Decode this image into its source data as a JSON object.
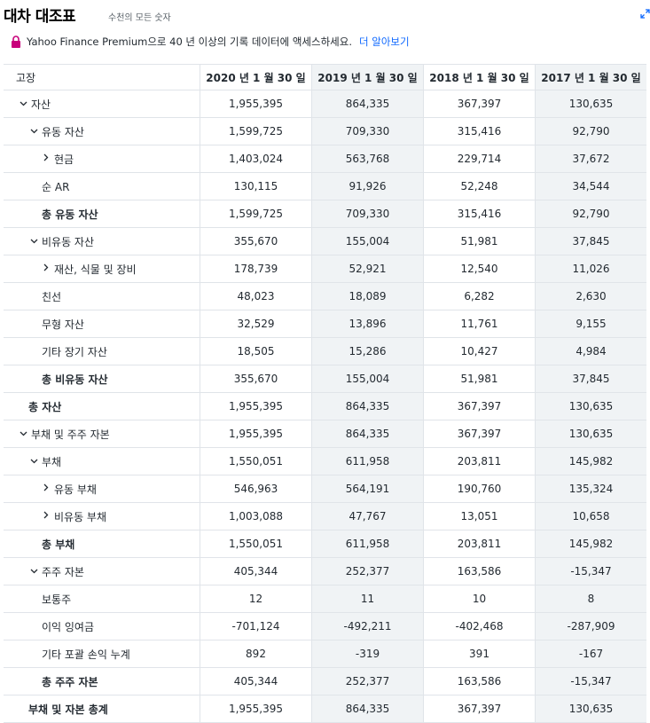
{
  "header": {
    "title": "대차 대조표",
    "subtitle": "수천의 모든 숫자"
  },
  "promo": {
    "text": "Yahoo Finance Premium으로 40 년 이상의 기록 데이터에 액세스하세요.",
    "link": "더 알아보기",
    "lock_color": "#c8007b"
  },
  "table": {
    "columns": [
      "고장",
      "2020 년 1 월 30 일",
      "2019 년 1 월 30 일",
      "2018 년 1 월 30 일",
      "2017 년 1 월 30 일"
    ],
    "rows": [
      {
        "label": "자산",
        "level": "l0",
        "chevron": "down",
        "bold": false,
        "values": [
          "1,955,395",
          "864,335",
          "367,397",
          "130,635"
        ]
      },
      {
        "label": "유동 자산",
        "level": "l1",
        "chevron": "down",
        "bold": false,
        "values": [
          "1,599,725",
          "709,330",
          "315,416",
          "92,790"
        ]
      },
      {
        "label": "현금",
        "level": "l2",
        "chevron": "right",
        "bold": false,
        "values": [
          "1,403,024",
          "563,768",
          "229,714",
          "37,672"
        ]
      },
      {
        "label": "순 AR",
        "level": "l1n",
        "chevron": "",
        "bold": false,
        "values": [
          "130,115",
          "91,926",
          "52,248",
          "34,544"
        ]
      },
      {
        "label": "총 유동 자산",
        "level": "l1n",
        "chevron": "",
        "bold": true,
        "values": [
          "1,599,725",
          "709,330",
          "315,416",
          "92,790"
        ]
      },
      {
        "label": "비유동 자산",
        "level": "l1",
        "chevron": "down",
        "bold": false,
        "values": [
          "355,670",
          "155,004",
          "51,981",
          "37,845"
        ]
      },
      {
        "label": "재산, 식물 및 장비",
        "level": "l2",
        "chevron": "right",
        "bold": false,
        "values": [
          "178,739",
          "52,921",
          "12,540",
          "11,026"
        ]
      },
      {
        "label": "친선",
        "level": "l1n",
        "chevron": "",
        "bold": false,
        "values": [
          "48,023",
          "18,089",
          "6,282",
          "2,630"
        ]
      },
      {
        "label": "무형 자산",
        "level": "l1n",
        "chevron": "",
        "bold": false,
        "values": [
          "32,529",
          "13,896",
          "11,761",
          "9,155"
        ]
      },
      {
        "label": "기타 장기 자산",
        "level": "l1n",
        "chevron": "",
        "bold": false,
        "values": [
          "18,505",
          "15,286",
          "10,427",
          "4,984"
        ]
      },
      {
        "label": "총 비유동 자산",
        "level": "l1n",
        "chevron": "",
        "bold": true,
        "values": [
          "355,670",
          "155,004",
          "51,981",
          "37,845"
        ]
      },
      {
        "label": "총 자산",
        "level": "l0n",
        "chevron": "",
        "bold": true,
        "values": [
          "1,955,395",
          "864,335",
          "367,397",
          "130,635"
        ]
      },
      {
        "label": "부채 및 주주 자본",
        "level": "l0",
        "chevron": "down",
        "bold": false,
        "values": [
          "1,955,395",
          "864,335",
          "367,397",
          "130,635"
        ]
      },
      {
        "label": "부채",
        "level": "l1",
        "chevron": "down",
        "bold": false,
        "values": [
          "1,550,051",
          "611,958",
          "203,811",
          "145,982"
        ]
      },
      {
        "label": "유동 부채",
        "level": "l2",
        "chevron": "right",
        "bold": false,
        "values": [
          "546,963",
          "564,191",
          "190,760",
          "135,324"
        ]
      },
      {
        "label": "비유동 부채",
        "level": "l2",
        "chevron": "right",
        "bold": false,
        "values": [
          "1,003,088",
          "47,767",
          "13,051",
          "10,658"
        ]
      },
      {
        "label": "총 부채",
        "level": "l1n",
        "chevron": "",
        "bold": true,
        "values": [
          "1,550,051",
          "611,958",
          "203,811",
          "145,982"
        ]
      },
      {
        "label": "주주 자본",
        "level": "l1",
        "chevron": "down",
        "bold": false,
        "values": [
          "405,344",
          "252,377",
          "163,586",
          "-15,347"
        ]
      },
      {
        "label": "보통주",
        "level": "l1n",
        "chevron": "",
        "bold": false,
        "values": [
          "12",
          "11",
          "10",
          "8"
        ]
      },
      {
        "label": "이익 잉여금",
        "level": "l1n",
        "chevron": "",
        "bold": false,
        "values": [
          "-701,124",
          "-492,211",
          "-402,468",
          "-287,909"
        ]
      },
      {
        "label": "기타 포괄 손익 누계",
        "level": "l1n",
        "chevron": "",
        "bold": false,
        "values": [
          "892",
          "-319",
          "391",
          "-167"
        ]
      },
      {
        "label": "총 주주 자본",
        "level": "l1n",
        "chevron": "",
        "bold": true,
        "values": [
          "405,344",
          "252,377",
          "163,586",
          "-15,347"
        ]
      },
      {
        "label": "부채 및 자본 총계",
        "level": "l0n",
        "chevron": "",
        "bold": true,
        "values": [
          "1,955,395",
          "864,335",
          "367,397",
          "130,635"
        ]
      }
    ]
  }
}
